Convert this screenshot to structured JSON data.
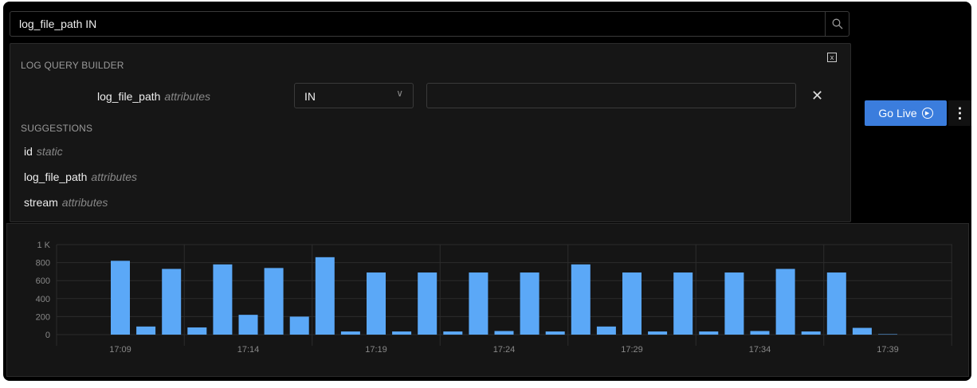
{
  "search": {
    "value": "log_file_path IN"
  },
  "builder": {
    "title": "LOG QUERY BUILDER",
    "field": "log_file_path",
    "field_type": "attributes",
    "operator": "IN",
    "value": "",
    "close_label": "x"
  },
  "suggestions_title": "SUGGESTIONS",
  "suggestions": [
    {
      "name": "id",
      "type": "static"
    },
    {
      "name": "log_file_path",
      "type": "attributes"
    },
    {
      "name": "stream",
      "type": "attributes"
    }
  ],
  "go_live": "Go Live",
  "colors": {
    "bar": "#5ba8f7",
    "button": "#3b7ddd"
  },
  "chart_data": {
    "type": "bar",
    "x": [
      "17:09",
      "17:10",
      "17:11",
      "17:12",
      "17:13",
      "17:14",
      "17:15",
      "17:16",
      "17:17",
      "17:18",
      "17:19",
      "17:20",
      "17:21",
      "17:22",
      "17:23",
      "17:24",
      "17:25",
      "17:26",
      "17:27",
      "17:28",
      "17:29",
      "17:30",
      "17:31",
      "17:32",
      "17:33",
      "17:34",
      "17:35",
      "17:36",
      "17:37",
      "17:38",
      "17:39"
    ],
    "values": [
      820,
      90,
      730,
      80,
      780,
      220,
      740,
      200,
      860,
      35,
      690,
      35,
      690,
      35,
      690,
      40,
      690,
      35,
      780,
      90,
      690,
      35,
      690,
      35,
      690,
      40,
      730,
      35,
      690,
      75,
      5
    ],
    "xticks": [
      "17:09",
      "17:14",
      "17:19",
      "17:24",
      "17:29",
      "17:34",
      "17:39"
    ],
    "yticks": [
      "0",
      "200",
      "400",
      "600",
      "800",
      "1 K"
    ],
    "ylim": [
      0,
      1000
    ],
    "grid": true
  }
}
